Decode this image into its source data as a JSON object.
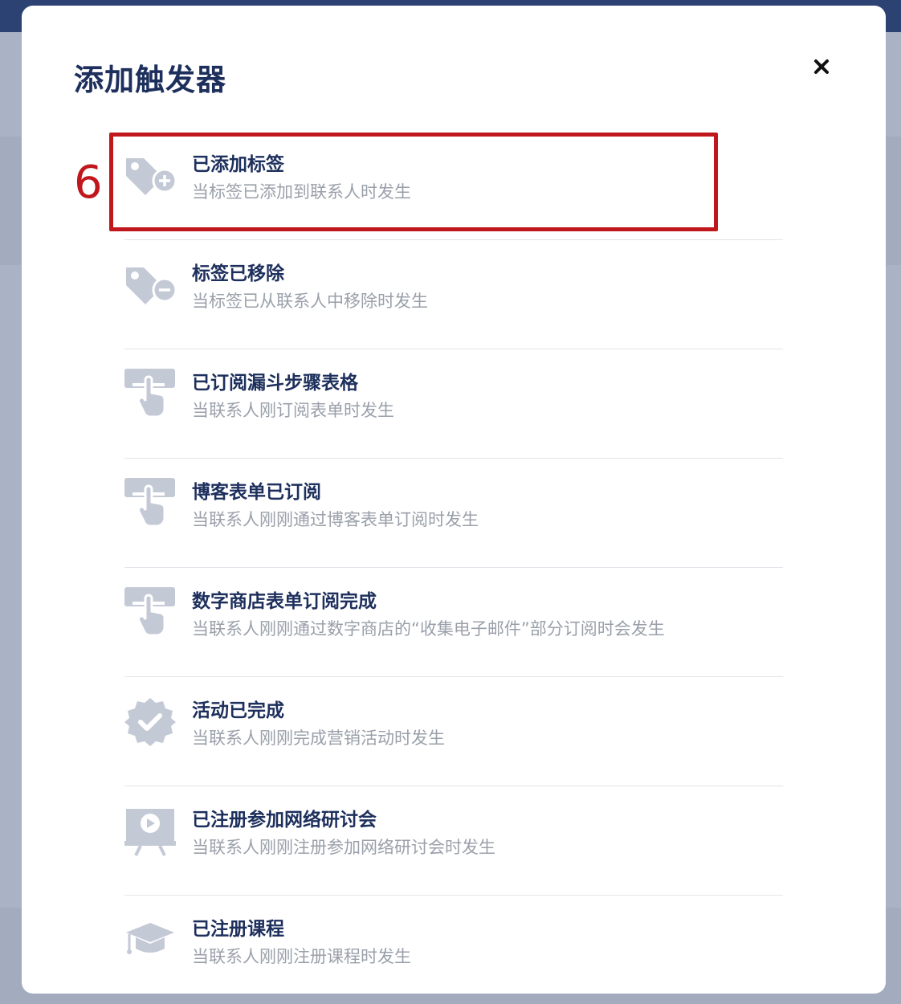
{
  "dialog": {
    "title": "添加触发器",
    "close_label": "×"
  },
  "annotation": {
    "step_number": "6",
    "highlight_color": "#c0171c"
  },
  "colors": {
    "title": "#1d2f5c",
    "description": "#9aa0aa",
    "icon": "#c4c9d6",
    "header_bar": "#2c4273"
  },
  "triggers": [
    {
      "icon": "tag-add-icon",
      "name": "已添加标签",
      "description": "当标签已添加到联系人时发生"
    },
    {
      "icon": "tag-remove-icon",
      "name": "标签已移除",
      "description": "当标签已从联系人中移除时发生"
    },
    {
      "icon": "form-pointer-icon",
      "name": "已订阅漏斗步骤表格",
      "description": "当联系人刚订阅表单时发生"
    },
    {
      "icon": "form-pointer-icon",
      "name": "博客表单已订阅",
      "description": "当联系人刚刚通过博客表单订阅时发生"
    },
    {
      "icon": "form-pointer-icon",
      "name": "数字商店表单订阅完成",
      "description": "当联系人刚刚通过数字商店的“收集电子邮件”部分订阅时会发生"
    },
    {
      "icon": "verified-badge-icon",
      "name": "活动已完成",
      "description": "当联系人刚刚完成营销活动时发生"
    },
    {
      "icon": "webinar-presentation-icon",
      "name": "已注册参加网络研讨会",
      "description": "当联系人刚刚注册参加网络研讨会时发生"
    },
    {
      "icon": "graduation-cap-icon",
      "name": "已注册课程",
      "description": "当联系人刚刚注册课程时发生"
    }
  ]
}
